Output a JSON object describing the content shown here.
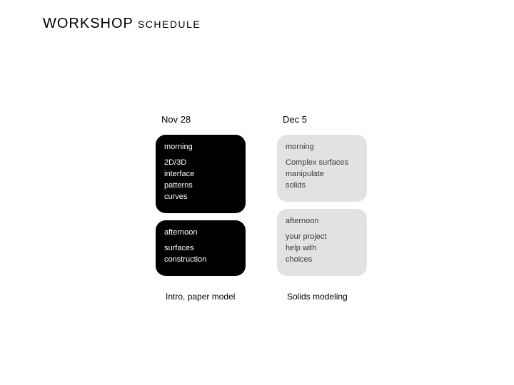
{
  "title_big": "WORKSHOP",
  "title_small": "SCHEDULE",
  "columns": {
    "left": {
      "date": "Nov 28",
      "morning_hdr": "morning",
      "m1": "2D/3D",
      "m2": "interface",
      "m3": "patterns",
      "m4": "curves",
      "afternoon_hdr": "afternoon",
      "a1": "surfaces",
      "a2": "construction",
      "footer1": "Intro,",
      "footer2": "paper",
      "footer3": "model"
    },
    "right": {
      "date": "Dec 5",
      "morning_hdr": "morning",
      "m1": "Complex surfaces",
      "m2": "manipulate",
      "m3": "solids",
      "afternoon_hdr": "afternoon",
      "a1": "your project",
      "a2": "help with",
      "a3": "choices",
      "footer1": "Solids",
      "footer2": "modeling"
    }
  }
}
